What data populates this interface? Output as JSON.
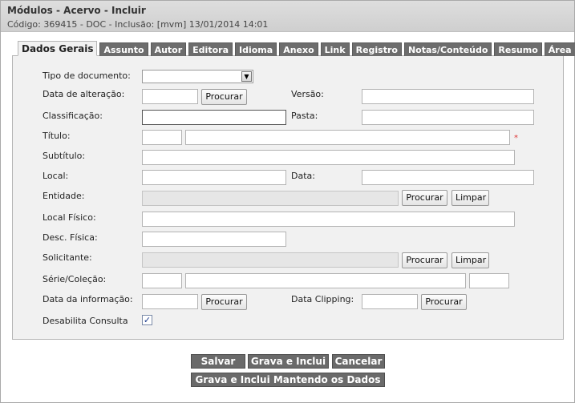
{
  "header": {
    "title": "Módulos - Acervo - Incluir",
    "subtitle": "Código: 369415 - DOC - Inclusão: [mvm] 13/01/2014 14:01"
  },
  "tabs": [
    {
      "label": "Dados Gerais",
      "active": true
    },
    {
      "label": "Assunto"
    },
    {
      "label": "Autor"
    },
    {
      "label": "Editora"
    },
    {
      "label": "Idioma"
    },
    {
      "label": "Anexo"
    },
    {
      "label": "Link"
    },
    {
      "label": "Registro"
    },
    {
      "label": "Notas/Conteúdo"
    },
    {
      "label": "Resumo"
    },
    {
      "label": "Área"
    }
  ],
  "form": {
    "tipo_documento_label": "Tipo de documento:",
    "tipo_documento_value": "",
    "data_alteracao_label": "Data de alteração:",
    "versao_label": "Versão:",
    "classificacao_label": "Classificação:",
    "pasta_label": "Pasta:",
    "titulo_label": "Título:",
    "required_mark": "*",
    "subtitulo_label": "Subtítulo:",
    "local_label": "Local:",
    "data_label": "Data:",
    "entidade_label": "Entidade:",
    "local_fisico_label": "Local Físico:",
    "desc_fisica_label": "Desc. Física:",
    "solicitante_label": "Solicitante:",
    "serie_colecao_label": "Série/Coleção:",
    "data_informacao_label": "Data da informação:",
    "data_clipping_label": "Data Clipping:",
    "desabilita_consulta_label": "Desabilita Consulta",
    "desabilita_consulta_checked": true,
    "check_glyph": "✓"
  },
  "buttons": {
    "procurar": "Procurar",
    "limpar": "Limpar",
    "salvar": "Salvar",
    "grava_inclui": "Grava e Inclui",
    "cancelar": "Cancelar",
    "grava_inclui_mantendo": "Grava e Inclui Mantendo os Dados"
  },
  "icons": {
    "select_arrow": "chevron-down-icon",
    "arrow_glyph": "▼"
  },
  "colors": {
    "tab_bg": "#6d6d6d",
    "panel_bg": "#f1f1f1",
    "button_dark": "#6a6a6a",
    "required": "#dd3333"
  }
}
